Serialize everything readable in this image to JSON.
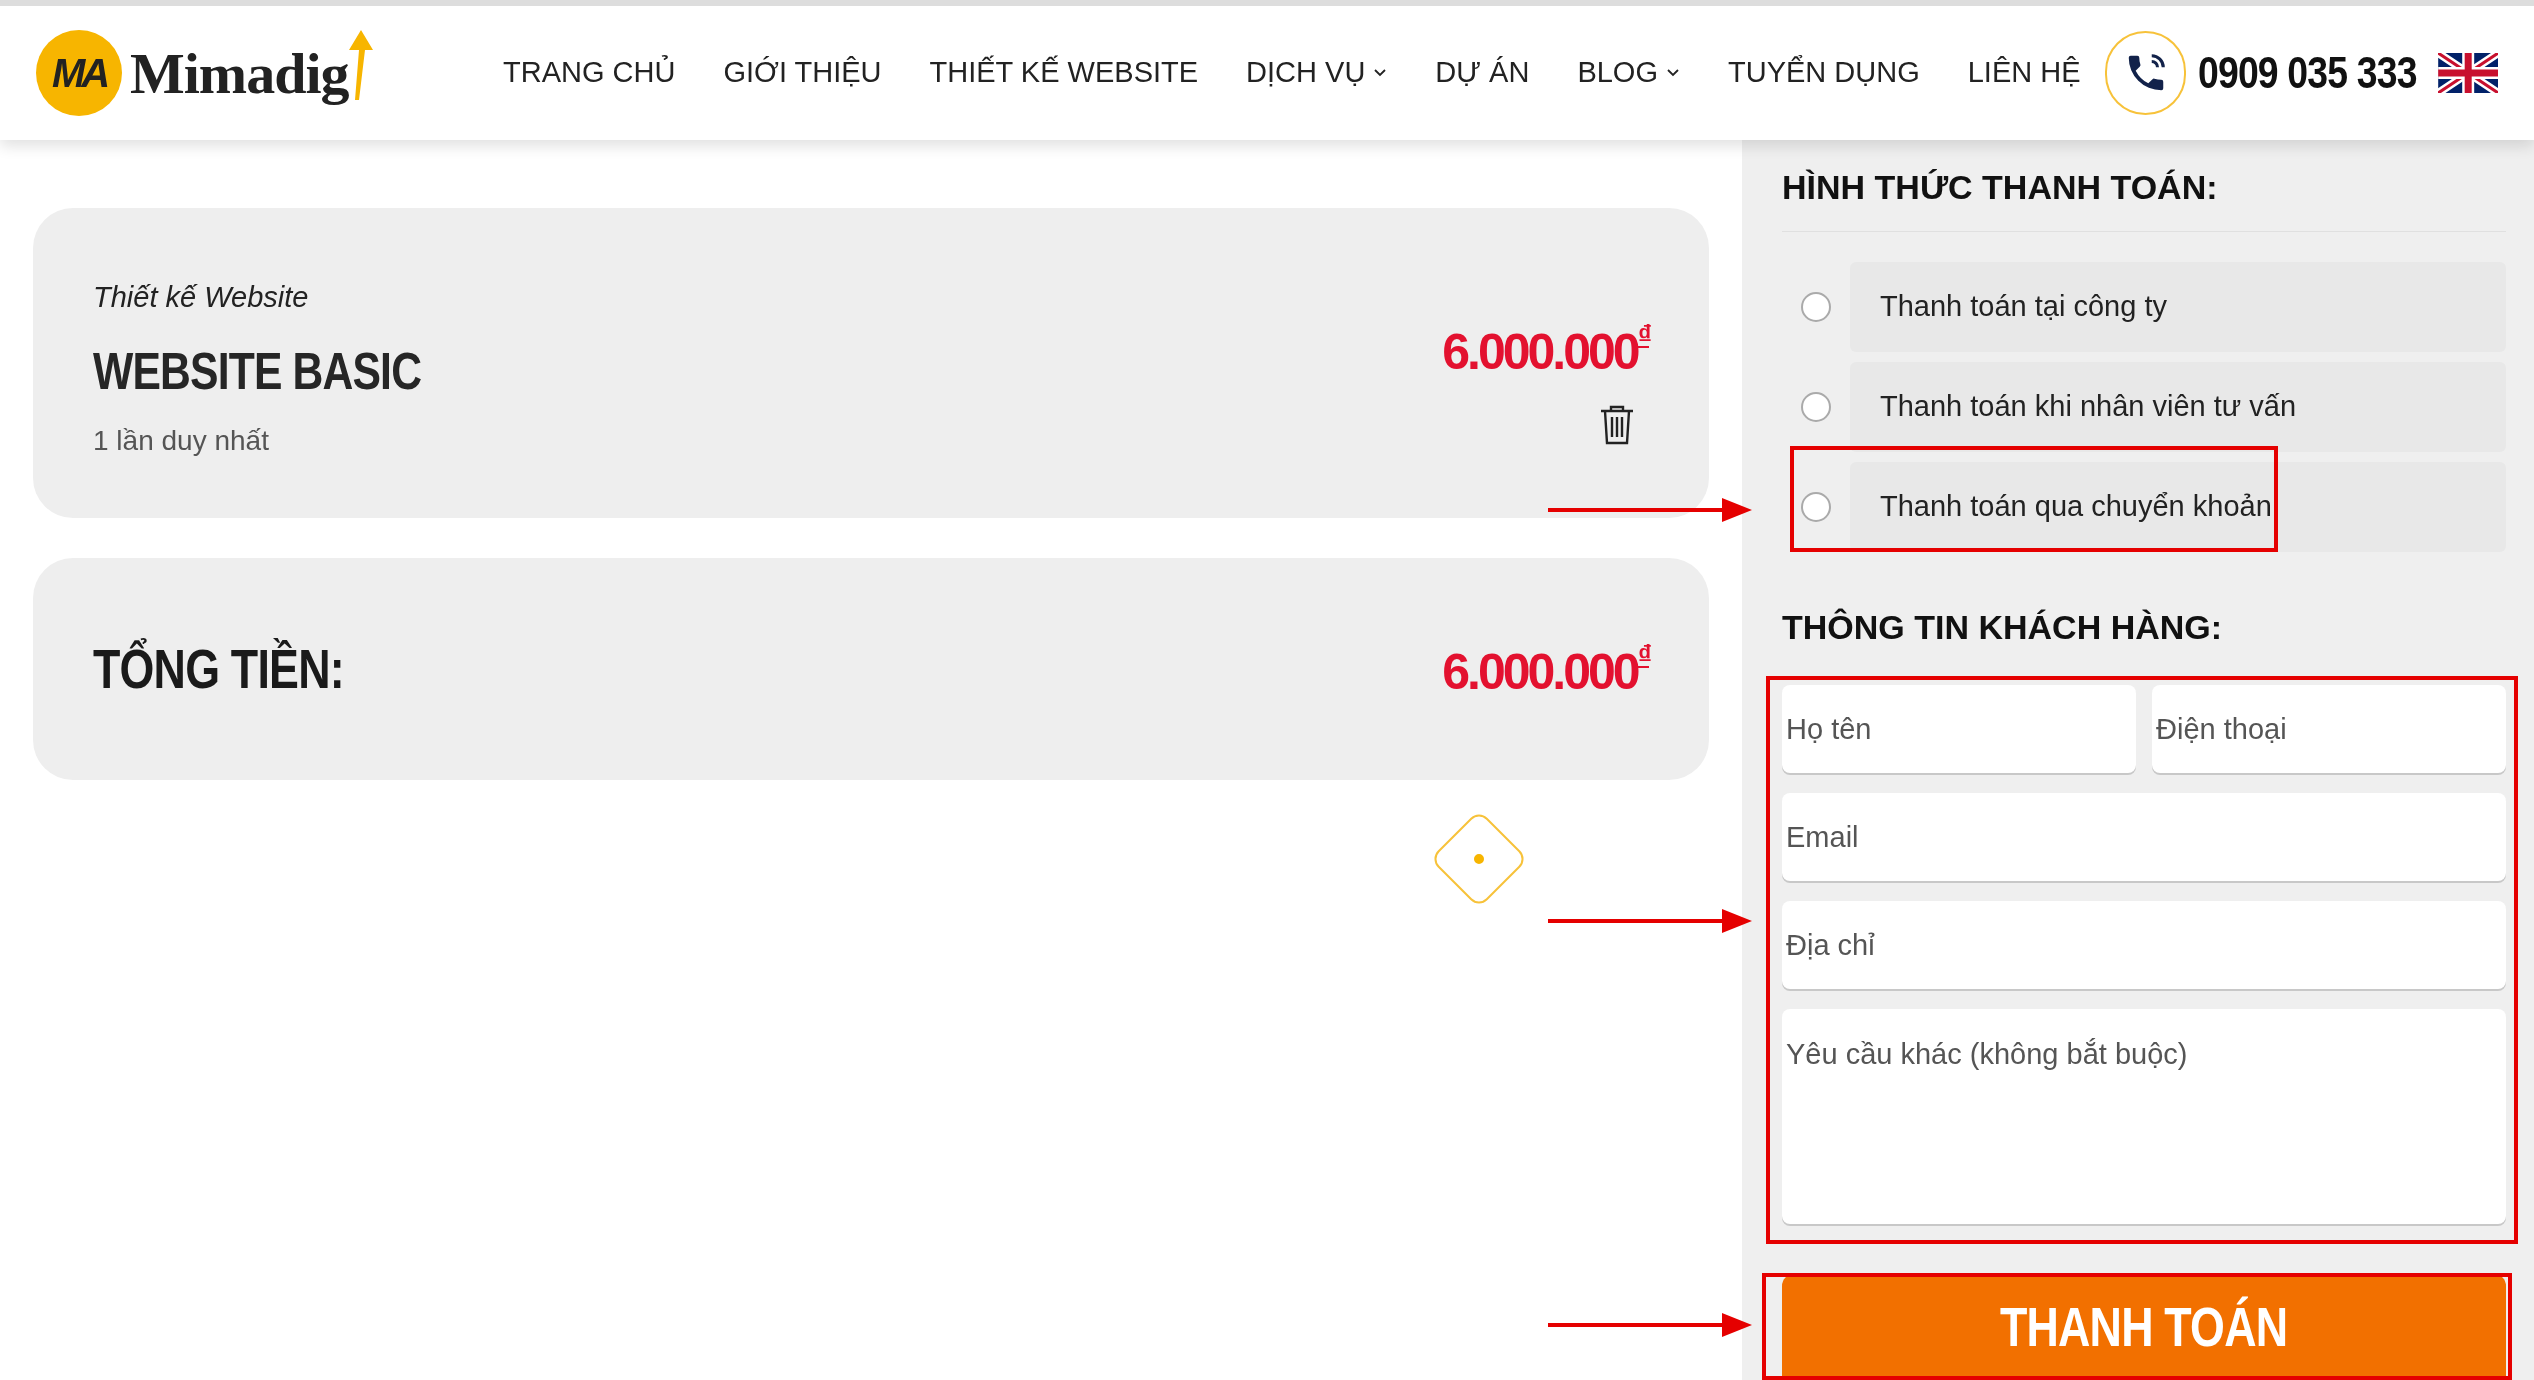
{
  "logo": {
    "mark": "MA",
    "text": "Mimadig"
  },
  "nav": [
    {
      "label": "TRANG CHỦ",
      "dropdown": false
    },
    {
      "label": "GIỚI THIỆU",
      "dropdown": false
    },
    {
      "label": "THIẾT KẾ WEBSITE",
      "dropdown": false
    },
    {
      "label": "DỊCH VỤ",
      "dropdown": true
    },
    {
      "label": "DỰ ÁN",
      "dropdown": false
    },
    {
      "label": "BLOG",
      "dropdown": true
    },
    {
      "label": "TUYỂN DỤNG",
      "dropdown": false
    },
    {
      "label": "LIÊN HỆ",
      "dropdown": false
    }
  ],
  "phone": "0909 035 333",
  "cart": {
    "item": {
      "category": "Thiết kế Website",
      "name": "WEBSITE BASIC",
      "term": "1 lần duy nhất",
      "price": "6.000.000",
      "currency": "₫"
    },
    "total": {
      "label": "TỔNG TIỀN:",
      "price": "6.000.000",
      "currency": "₫"
    }
  },
  "payment": {
    "heading": "HÌNH THỨC THANH TOÁN:",
    "options": [
      {
        "label": "Thanh toán tại công ty",
        "selected": false
      },
      {
        "label": "Thanh toán khi nhân viên tư vấn",
        "selected": false
      },
      {
        "label": "Thanh toán qua chuyển khoản",
        "selected": false
      }
    ]
  },
  "customer": {
    "heading": "THÔNG TIN KHÁCH HÀNG:",
    "fields": [
      {
        "kind": "half",
        "placeholder": "Họ tên"
      },
      {
        "kind": "half",
        "placeholder": "Điện thoại"
      },
      {
        "kind": "full",
        "placeholder": "Email"
      },
      {
        "kind": "full",
        "placeholder": "Địa chỉ"
      },
      {
        "kind": "textarea",
        "placeholder": "Yêu cầu khác (không bắt buộc)"
      }
    ]
  },
  "submit": "THANH TOÁN"
}
